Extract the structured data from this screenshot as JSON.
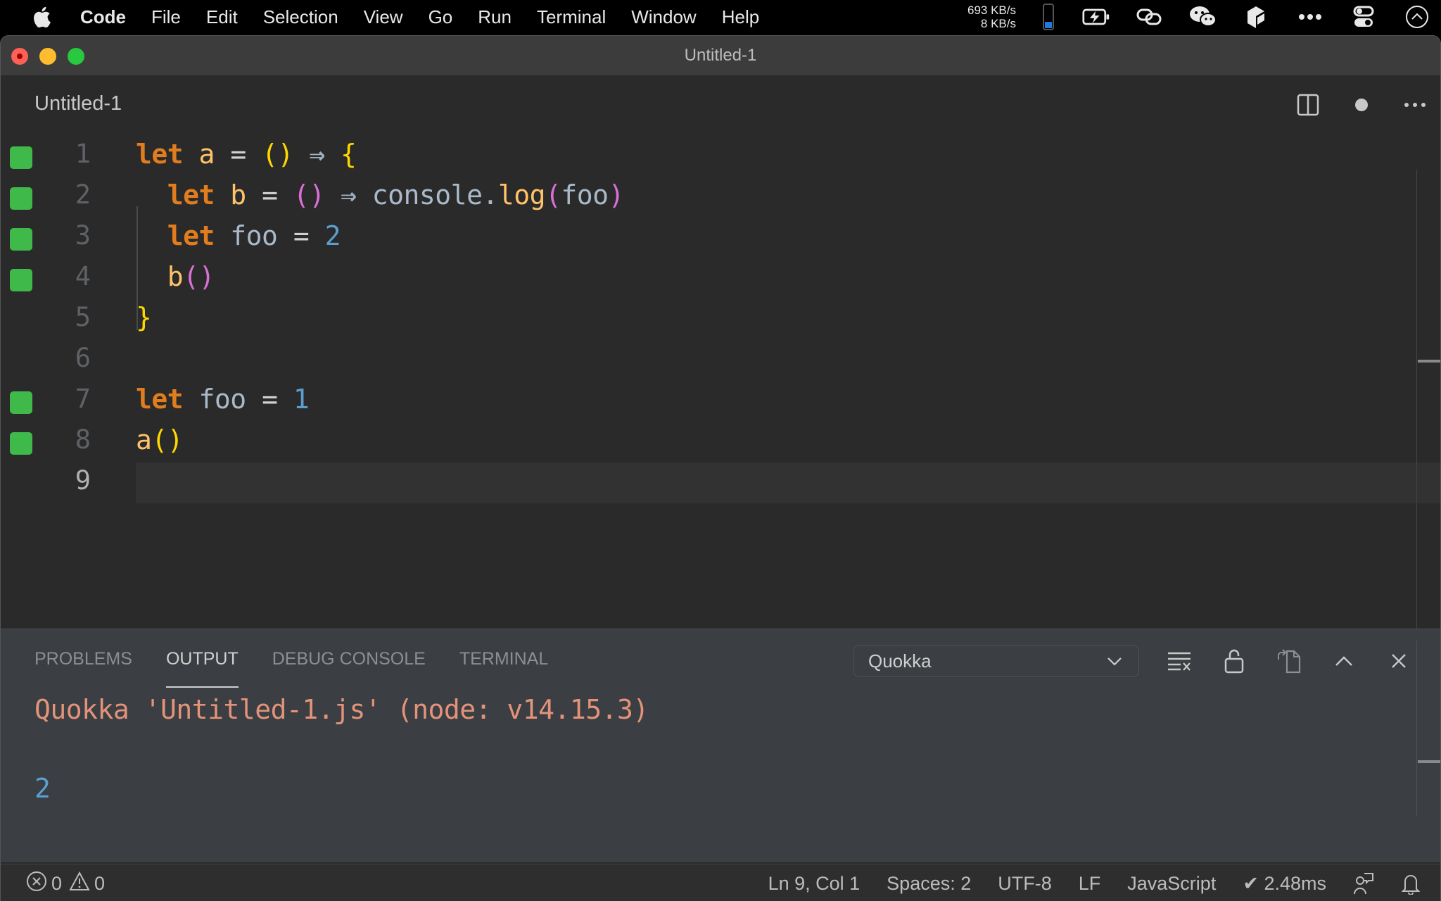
{
  "menubar": {
    "app_name": "Code",
    "items": [
      "File",
      "Edit",
      "Selection",
      "View",
      "Go",
      "Run",
      "Terminal",
      "Window",
      "Help"
    ],
    "net_up": "693 KB/s",
    "net_down": "8 KB/s",
    "tray_icons": [
      "battery-level-icon",
      "battery-charging-icon",
      "link-icon",
      "wechat-icon",
      "app-icon",
      "more-icon",
      "control-center-icon",
      "siri-icon"
    ]
  },
  "window": {
    "title": "Untitled-1"
  },
  "tab": {
    "title": "Untitled-1",
    "actions": [
      "split-editor-icon",
      "unsaved-dot-icon",
      "more-actions-icon"
    ]
  },
  "editor": {
    "current_line": 9,
    "lines": [
      {
        "num": "1",
        "covered": true
      },
      {
        "num": "2",
        "covered": true
      },
      {
        "num": "3",
        "covered": true
      },
      {
        "num": "4",
        "covered": true
      },
      {
        "num": "5",
        "covered": false
      },
      {
        "num": "6",
        "covered": false
      },
      {
        "num": "7",
        "covered": true
      },
      {
        "num": "8",
        "covered": true
      },
      {
        "num": "9",
        "covered": false
      }
    ],
    "tokens": {
      "l1": {
        "kw": "let",
        "name": "a",
        "eq": "=",
        "parens": "()",
        "arrow": "⇒",
        "brace": "{"
      },
      "l2": {
        "kw": "let",
        "name": "b",
        "eq": "=",
        "parens": "()",
        "arrow": "⇒",
        "obj": "console.",
        "method": "log",
        "open": "(",
        "arg": "foo",
        "close": ")"
      },
      "l3": {
        "kw": "let",
        "name": "foo",
        "eq": "=",
        "value": "2"
      },
      "l4": {
        "call": "b",
        "parens": "()"
      },
      "l5": {
        "brace": "}"
      },
      "l7": {
        "kw": "let",
        "name": "foo",
        "eq": "=",
        "value": "1"
      },
      "l8": {
        "call": "a",
        "parens": "()"
      }
    }
  },
  "panel": {
    "tabs": [
      {
        "label": "PROBLEMS",
        "active": false
      },
      {
        "label": "OUTPUT",
        "active": true
      },
      {
        "label": "DEBUG CONSOLE",
        "active": false
      },
      {
        "label": "TERMINAL",
        "active": false
      }
    ],
    "channel_select": "Quokka",
    "actions": [
      "clear-output-icon",
      "lock-scroll-icon",
      "open-in-editor-icon",
      "maximize-panel-icon",
      "close-panel-icon"
    ],
    "output_header": "Quokka 'Untitled-1.js' (node: v14.15.3)",
    "output_value": "2"
  },
  "statusbar": {
    "errors": "0",
    "warnings": "0",
    "position": "Ln 9, Col 1",
    "indent": "Spaces: 2",
    "encoding": "UTF-8",
    "eol": "LF",
    "language": "JavaScript",
    "quokka_time": "✔ 2.48ms"
  },
  "colors": {
    "coverage_green": "#3fb94a",
    "keyword": "#e07d1e",
    "number": "#5b9fcf",
    "output_header": "#e3937a"
  }
}
